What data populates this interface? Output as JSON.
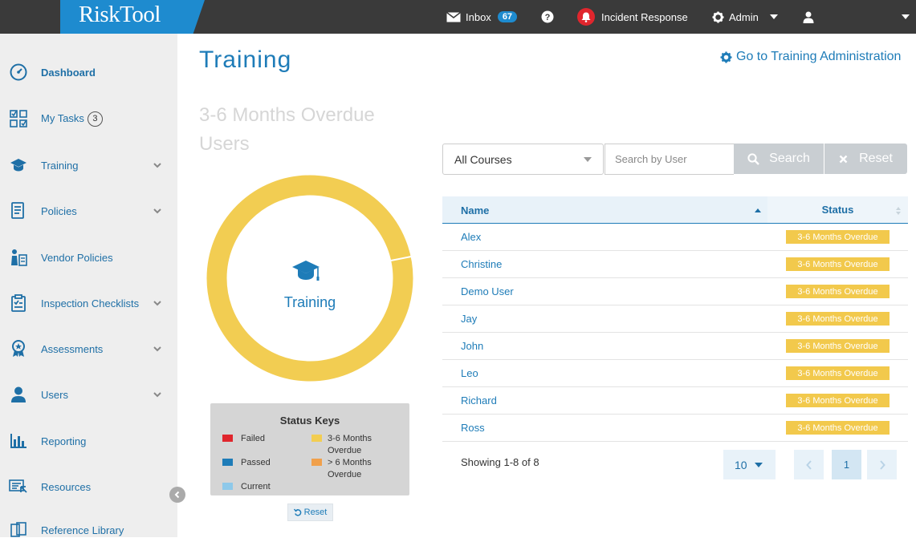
{
  "app": {
    "logo": "RiskTool"
  },
  "topbar": {
    "inbox_label": "Inbox",
    "inbox_count": "67",
    "incident_label": "Incident Response",
    "admin_label": "Admin"
  },
  "sidebar": {
    "items": [
      {
        "label": "Dashboard",
        "icon": "dashboard-gauge-icon"
      },
      {
        "label": "My Tasks",
        "icon": "tasks-icon",
        "badge": "3"
      },
      {
        "label": "Training",
        "icon": "graduation-cap-icon"
      },
      {
        "label": "Policies",
        "icon": "policies-icon"
      },
      {
        "label": "Vendor Policies",
        "icon": "vendor-icon"
      },
      {
        "label": "Inspection Checklists",
        "icon": "clipboard-icon"
      },
      {
        "label": "Assessments",
        "icon": "award-icon"
      },
      {
        "label": "Users",
        "icon": "user-icon"
      },
      {
        "label": "Reporting",
        "icon": "bar-chart-icon"
      },
      {
        "label": "Resources",
        "icon": "resources-icon"
      },
      {
        "label": "Reference Library",
        "icon": "library-icon"
      }
    ]
  },
  "main": {
    "title": "Training",
    "admin_link": "Go to Training Administration",
    "chart_title": "3-6 Months Overdue Users",
    "donut_label": "Training",
    "status_keys": {
      "title": "Status Keys",
      "failed": "Failed",
      "passed": "Passed",
      "current": "Current",
      "overdue_3_6": "3-6 Months Overdue",
      "overdue_6": "> 6 Months Overdue"
    },
    "reset_label": "Reset"
  },
  "filters": {
    "course_select": "All Courses",
    "search_placeholder": "Search by User",
    "search_button": "Search",
    "reset_button": "Reset"
  },
  "table": {
    "headers": {
      "name": "Name",
      "status": "Status"
    },
    "rows": [
      {
        "name": "Alex",
        "status": "3-6 Months Overdue"
      },
      {
        "name": "Christine",
        "status": "3-6 Months Overdue"
      },
      {
        "name": "Demo User",
        "status": "3-6 Months Overdue"
      },
      {
        "name": "Jay",
        "status": "3-6 Months Overdue"
      },
      {
        "name": "John",
        "status": "3-6 Months Overdue"
      },
      {
        "name": "Leo",
        "status": "3-6 Months Overdue"
      },
      {
        "name": "Richard",
        "status": "3-6 Months Overdue"
      },
      {
        "name": "Ross",
        "status": "3-6 Months Overdue"
      }
    ],
    "showing": "Showing 1-8 of 8",
    "page_size": "10",
    "current_page": "1"
  },
  "colors": {
    "accent": "#1e7cb8",
    "failed": "#e0262d",
    "passed": "#1e7cb8",
    "current": "#8ec9ea",
    "overdue_3_6": "#f2c94c",
    "overdue_6": "#f0a04b"
  }
}
